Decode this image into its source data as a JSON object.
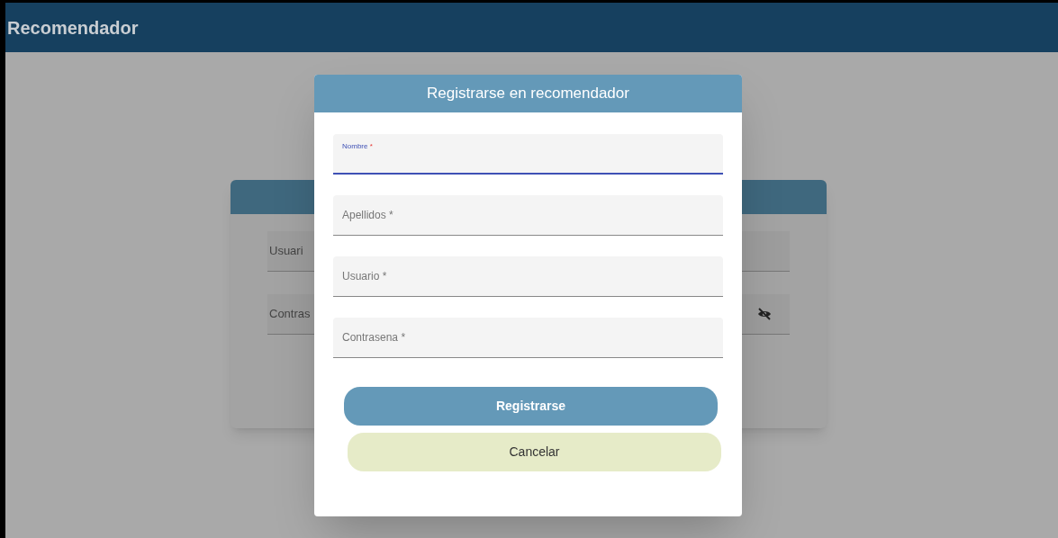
{
  "app_bar": {
    "title": "Recomendador"
  },
  "login_card": {
    "fields": [
      {
        "label": "Usuari",
        "password": false
      },
      {
        "label": "Contras",
        "password": true
      }
    ]
  },
  "dialog": {
    "title": "Registrarse en recomendador",
    "fields": [
      {
        "label": "Nombre",
        "required_mark": "*",
        "focused": true
      },
      {
        "label": "Apellidos",
        "required_mark": "*",
        "focused": false
      },
      {
        "label": "Usuario",
        "required_mark": "*",
        "focused": false
      },
      {
        "label": "Contrasena",
        "required_mark": "*",
        "focused": false
      }
    ],
    "buttons": [
      {
        "label": "Registrarse",
        "kind": "primary"
      },
      {
        "label": "Cancelar",
        "kind": "secondary"
      }
    ]
  }
}
